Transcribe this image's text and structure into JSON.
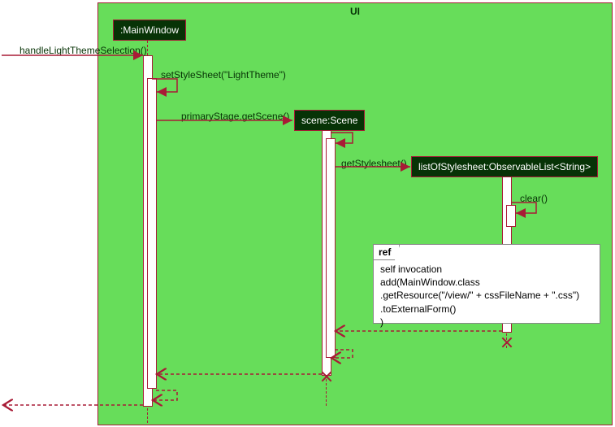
{
  "frame": {
    "label": "UI"
  },
  "lifelines": {
    "main": {
      "label": ":MainWindow"
    },
    "scene": {
      "label": "scene:Scene"
    },
    "list": {
      "label": "listOfStylesheet:ObservableList<String>"
    }
  },
  "messages": {
    "handle": "handleLightThemeSelection()",
    "setStyle": "setStyleSheet(\"LightTheme\")",
    "getScene": "primaryStage.getScene()",
    "getStylesheet": "getStylesheet()",
    "clear": "clear()"
  },
  "ref": {
    "tag": "ref",
    "line1": "self invocation",
    "line2": "add(MainWindow.class",
    "line3": ".getResource(\"/view/\" + cssFileName + \".css\")",
    "line4": ".toExternalForm()",
    "line5": ")"
  },
  "chart_data": {
    "type": "uml-sequence",
    "frame": "UI",
    "participants": [
      {
        "id": "main",
        "label": ":MainWindow",
        "created": "initial"
      },
      {
        "id": "scene",
        "label": "scene:Scene",
        "created": "by getScene",
        "destroyed": true
      },
      {
        "id": "list",
        "label": "listOfStylesheet:ObservableList<String>",
        "created": "by getStylesheet",
        "destroyed": true
      }
    ],
    "sequence": [
      {
        "from": "external",
        "to": "main",
        "label": "handleLightThemeSelection()",
        "kind": "call"
      },
      {
        "from": "main",
        "to": "main",
        "label": "setStyleSheet(\"LightTheme\")",
        "kind": "self-call"
      },
      {
        "from": "main",
        "to": "scene",
        "label": "primaryStage.getScene()",
        "kind": "create"
      },
      {
        "from": "scene",
        "to": "scene",
        "label": "",
        "kind": "self-call"
      },
      {
        "from": "scene",
        "to": "list",
        "label": "getStylesheet()",
        "kind": "create"
      },
      {
        "from": "list",
        "to": "list",
        "label": "clear()",
        "kind": "self-call"
      },
      {
        "kind": "ref",
        "over": [
          "list"
        ],
        "text": "self invocation\nadd(MainWindow.class\n.getResource(\"/view/\" + cssFileName + \".css\")\n.toExternalForm()\n)"
      },
      {
        "from": "list",
        "to": "scene",
        "kind": "return"
      },
      {
        "kind": "destroy",
        "target": "list"
      },
      {
        "from": "scene",
        "to": "scene",
        "kind": "self-return"
      },
      {
        "from": "scene",
        "to": "main",
        "kind": "return"
      },
      {
        "kind": "destroy",
        "target": "scene"
      },
      {
        "from": "main",
        "to": "main",
        "kind": "self-return"
      },
      {
        "from": "main",
        "to": "external",
        "kind": "return"
      }
    ]
  }
}
